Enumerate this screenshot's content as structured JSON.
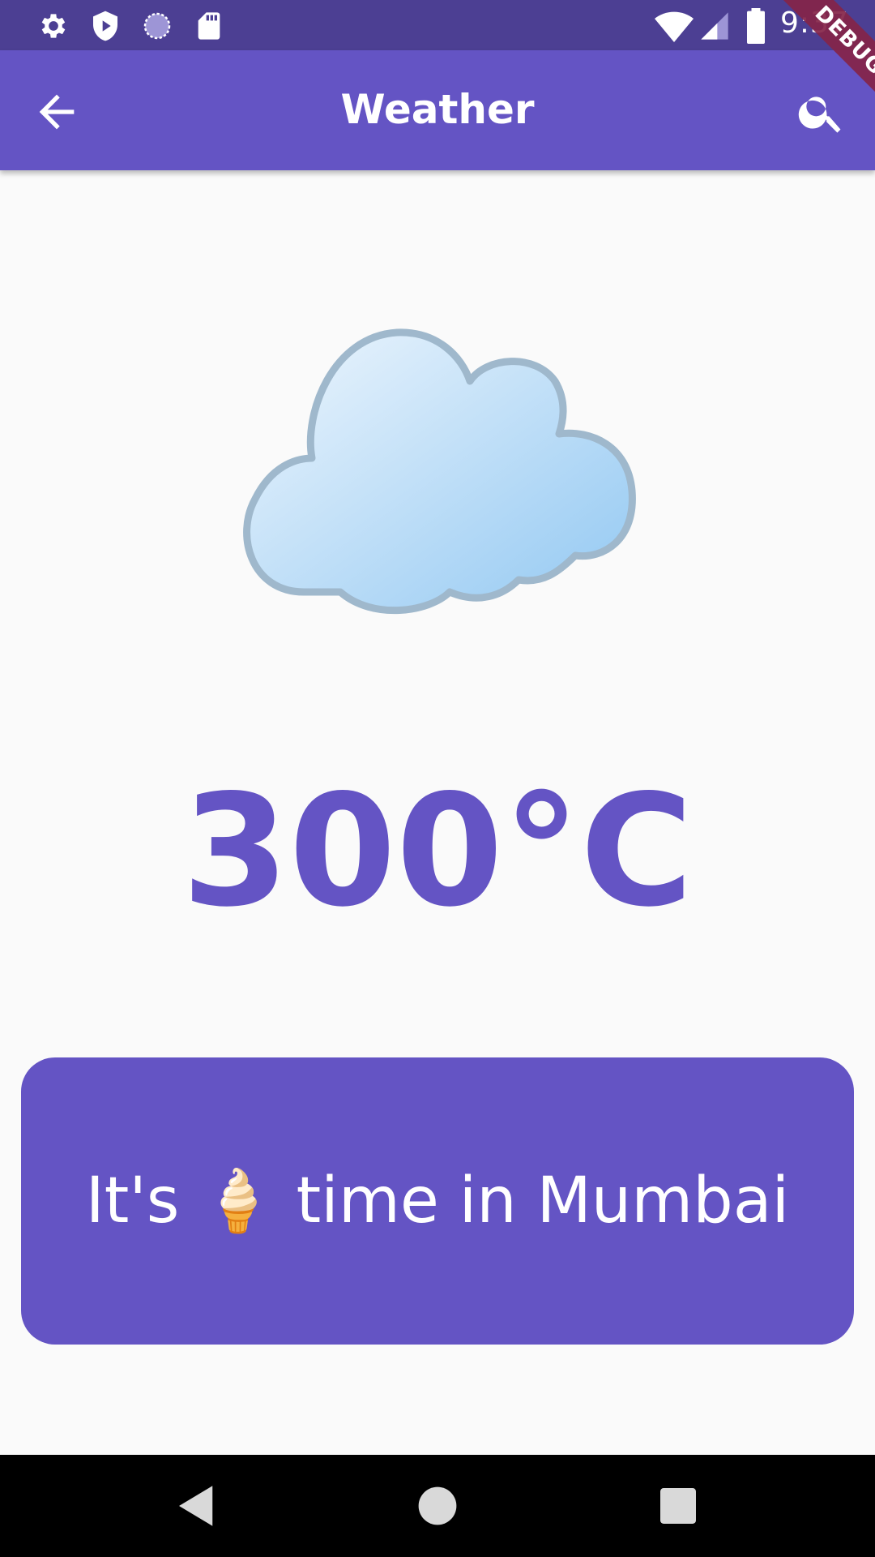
{
  "status_bar": {
    "time": "9:37",
    "icons": [
      "gear-icon",
      "shield-play-icon",
      "sync-circle-icon",
      "sd-card-icon",
      "wifi-icon",
      "cell-signal-icon",
      "battery-icon"
    ]
  },
  "app_bar": {
    "title": "Weather",
    "back_icon": "arrow-back-icon",
    "search_icon": "search-icon",
    "color": "#6454c4"
  },
  "debug_banner": "DEBUG",
  "weather": {
    "condition_icon": "cloud-icon",
    "temperature": "300°C",
    "accent_color": "#6454c4"
  },
  "message": {
    "prefix": "It's",
    "emoji": "🍦",
    "suffix": "time in Mumbai"
  },
  "nav_bar": {
    "buttons": [
      "back-triangle-icon",
      "home-circle-icon",
      "recents-square-icon"
    ]
  }
}
